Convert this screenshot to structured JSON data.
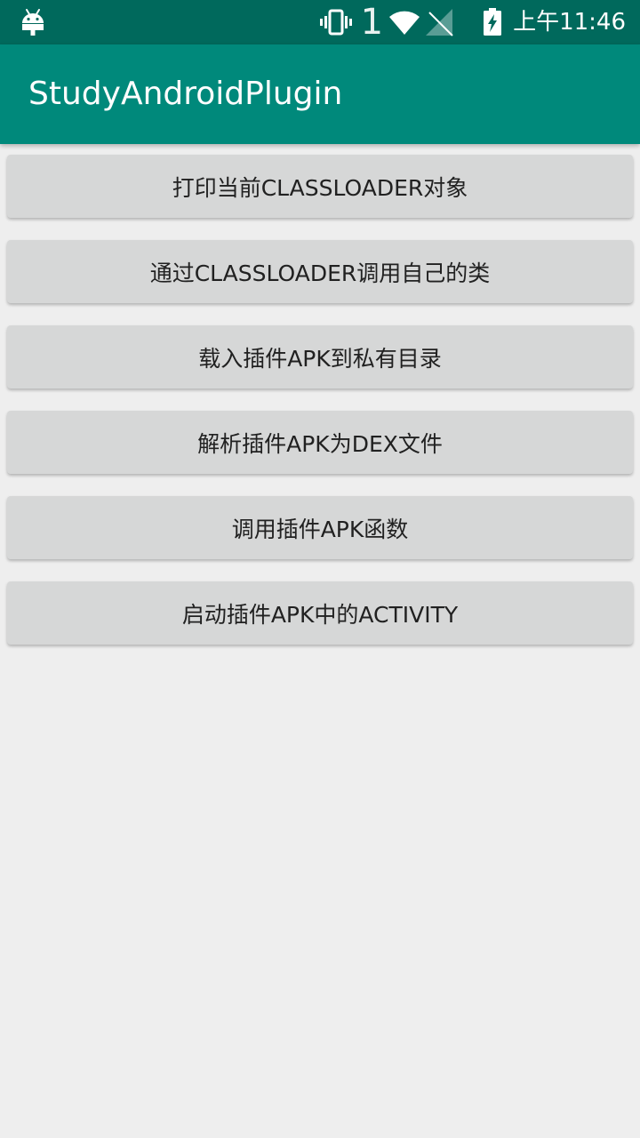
{
  "status_bar": {
    "left_icon": "android-debug-icon",
    "icons": [
      "vibrate-icon",
      "sim-1",
      "wifi-icon",
      "signal-off-icon",
      "battery-charging-icon"
    ],
    "sim_label": "1",
    "time": "上午11:46"
  },
  "app_bar": {
    "title": "StudyAndroidPlugin",
    "color": "#00897b",
    "status_color": "#00695c"
  },
  "buttons": [
    {
      "label": "打印当前CLASSLOADER对象"
    },
    {
      "label": "通过CLASSLOADER调用自己的类"
    },
    {
      "label": "载入插件APK到私有目录"
    },
    {
      "label": "解析插件APK为DEX文件"
    },
    {
      "label": "调用插件APK函数"
    },
    {
      "label": "启动插件APK中的ACTIVITY"
    }
  ]
}
